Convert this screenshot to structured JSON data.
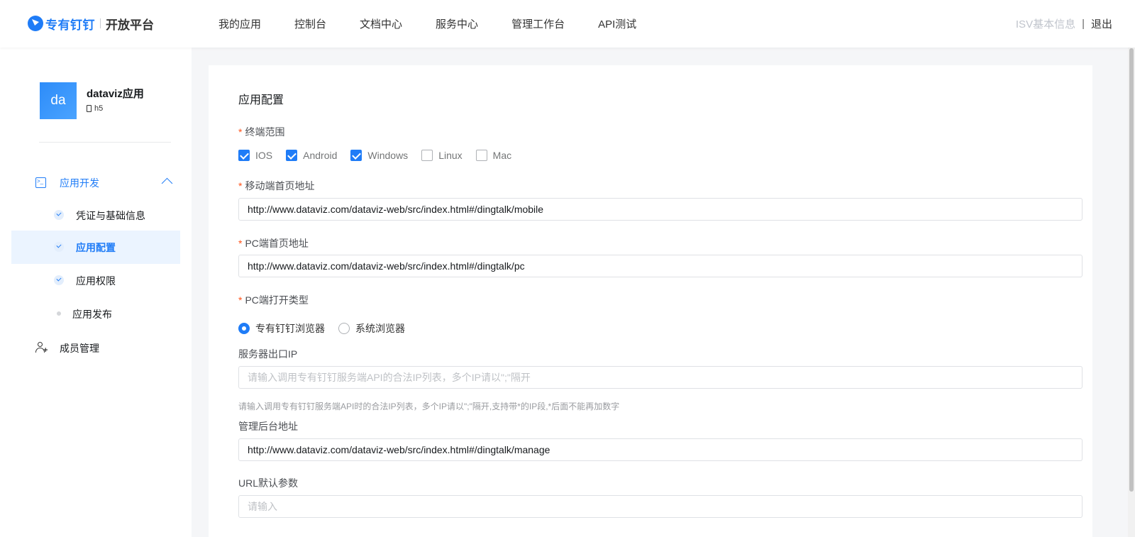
{
  "header": {
    "brand": "专有钉钉",
    "platform": "开放平台",
    "nav": [
      "我的应用",
      "控制台",
      "文档中心",
      "服务中心",
      "管理工作台",
      "API测试"
    ],
    "isv_info": "ISV基本信息",
    "separator": "|",
    "logout": "退出"
  },
  "sidebar": {
    "app": {
      "avatar": "da",
      "name": "dataviz应用",
      "type": "h5"
    },
    "group": {
      "label": "应用开发",
      "icon": "terminal-icon",
      "expanded": true
    },
    "items": [
      {
        "label": "凭证与基础信息",
        "status": "done",
        "active": false
      },
      {
        "label": "应用配置",
        "status": "done",
        "active": true
      },
      {
        "label": "应用权限",
        "status": "done",
        "active": false
      },
      {
        "label": "应用发布",
        "status": "pending",
        "active": false
      }
    ],
    "member": {
      "label": "成员管理",
      "icon": "user-add-icon"
    }
  },
  "form": {
    "title": "应用配置",
    "terminal": {
      "label": "终端范围",
      "required": true,
      "options": [
        {
          "label": "IOS",
          "checked": true
        },
        {
          "label": "Android",
          "checked": true
        },
        {
          "label": "Windows",
          "checked": true
        },
        {
          "label": "Linux",
          "checked": false
        },
        {
          "label": "Mac",
          "checked": false
        }
      ]
    },
    "mobile_url": {
      "label": "移动端首页地址",
      "required": true,
      "value": "http://www.dataviz.com/dataviz-web/src/index.html#/dingtalk/mobile"
    },
    "pc_url": {
      "label": "PC端首页地址",
      "required": true,
      "value": "http://www.dataviz.com/dataviz-web/src/index.html#/dingtalk/pc"
    },
    "pc_open_type": {
      "label": "PC端打开类型",
      "required": true,
      "options": [
        {
          "label": "专有钉钉浏览器",
          "selected": true
        },
        {
          "label": "系统浏览器",
          "selected": false
        }
      ]
    },
    "server_ip": {
      "label": "服务器出口IP",
      "value": "",
      "placeholder": "请输入调用专有钉钉服务端API的合法IP列表，多个IP请以\";\"隔开",
      "hint": "请输入调用专有钉钉服务端API时的合法IP列表，多个IP请以\";\"隔开,支持带*的IP段,*后面不能再加数字"
    },
    "admin_url": {
      "label": "管理后台地址",
      "value": "http://www.dataviz.com/dataviz-web/src/index.html#/dingtalk/manage"
    },
    "url_params": {
      "label": "URL默认参数",
      "value": "",
      "placeholder": "请输入"
    }
  },
  "colors": {
    "accent": "#1f7cf7",
    "required": "#ff5219",
    "active_bg": "#ebf4ff"
  }
}
